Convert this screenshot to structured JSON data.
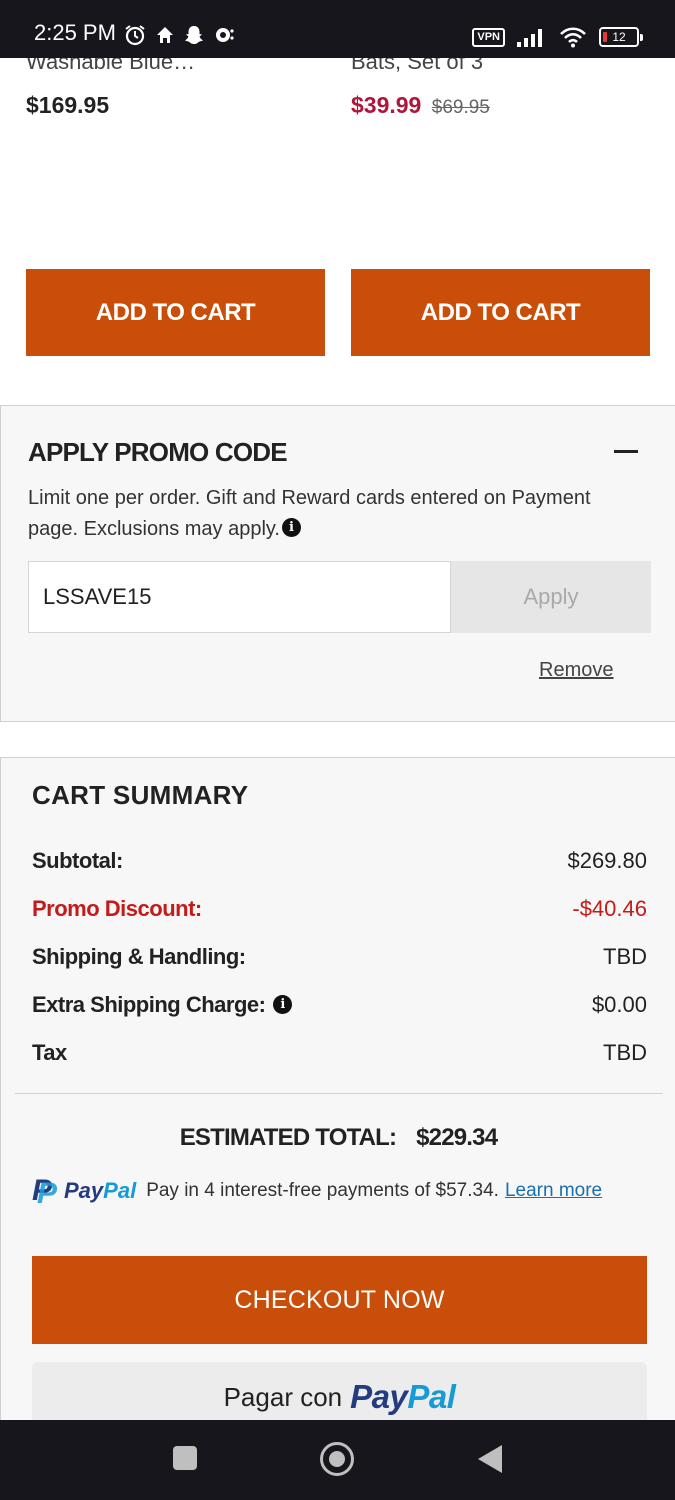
{
  "status_bar": {
    "time": "2:25 PM",
    "left_icons": [
      "alarm-icon",
      "home-icon",
      "snapchat-icon",
      "sync-icon"
    ],
    "vpn_label": "VPN",
    "battery_level": "12",
    "right_icons": [
      "vpn-icon",
      "signal-icon",
      "wifi-icon",
      "battery-icon"
    ]
  },
  "products": [
    {
      "name": "Washable Blue…",
      "price": "$169.95",
      "add_to_cart_label": "ADD TO CART"
    },
    {
      "name": "Bats, Set of 3",
      "sale_price": "$39.99",
      "original_price": "$69.95",
      "add_to_cart_label": "ADD TO CART"
    }
  ],
  "promo": {
    "title": "APPLY PROMO CODE",
    "description": "Limit one per order. Gift and Reward cards entered on Payment page. Exclusions may apply.",
    "code_value": "LSSAVE15",
    "apply_label": "Apply",
    "remove_label": "Remove"
  },
  "cart_summary": {
    "title": "CART SUMMARY",
    "rows": [
      {
        "label": "Subtotal:",
        "value": "$269.80"
      },
      {
        "label": "Promo Discount:",
        "value": "-$40.46"
      },
      {
        "label": "Shipping & Handling:",
        "value": "TBD"
      },
      {
        "label": "Extra Shipping Charge:",
        "value": "$0.00"
      },
      {
        "label": "Tax",
        "value": "TBD"
      }
    ],
    "estimated_total_label": "ESTIMATED TOTAL:",
    "estimated_total_value": "$229.34",
    "paypal_brand_pay": "Pay",
    "paypal_brand_pal": "Pal",
    "paypal_message": "Pay in 4 interest-free payments of $57.34.",
    "learn_more_label": "Learn more",
    "checkout_label": "CHECKOUT NOW",
    "paypal_button_text": "Pagar con",
    "paypal_button_brand_pay": "Pay",
    "paypal_button_brand_pal": "Pal"
  },
  "colors": {
    "accent_orange": "#c94e09",
    "sale_red": "#b0163a",
    "promo_red": "#c41a1a",
    "paypal_dark_blue": "#253b80",
    "paypal_light_blue": "#179bd7",
    "link_blue": "#1a6fb0"
  },
  "nav_bar": {
    "icons": [
      "recent-apps-icon",
      "home-button-icon",
      "back-icon"
    ]
  }
}
